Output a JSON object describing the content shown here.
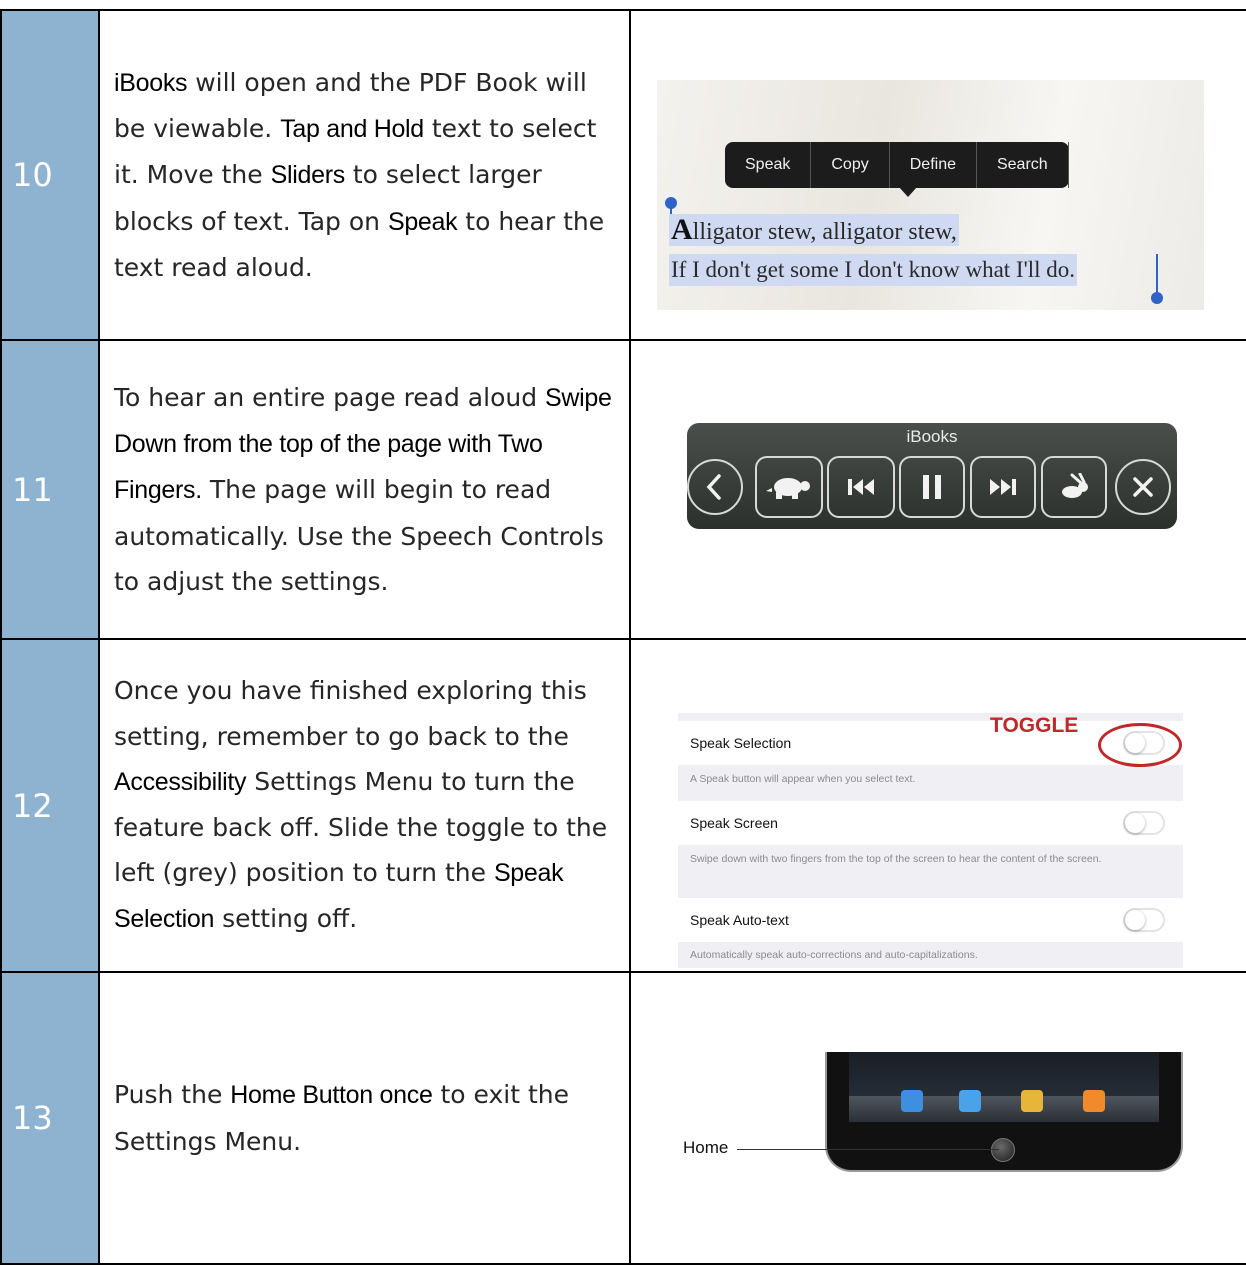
{
  "steps": [
    {
      "number": "10",
      "segments": [
        {
          "t": "iBooks",
          "k": true
        },
        {
          "t": " will open and the PDF Book will be viewable. ",
          "k": false
        },
        {
          "t": "Tap and Hold",
          "k": true
        },
        {
          "t": " text to select it. Move the ",
          "k": false
        },
        {
          "t": "Sliders",
          "k": true
        },
        {
          "t": " to select larger blocks of text. Tap on ",
          "k": false
        },
        {
          "t": "Speak",
          "k": true
        },
        {
          "t": " to hear the text read aloud.",
          "k": false
        }
      ]
    },
    {
      "number": "11",
      "segments": [
        {
          "t": "To hear an entire page read aloud ",
          "k": false
        },
        {
          "t": "Swipe Down from the top of the page with Two Fingers.",
          "k": true
        },
        {
          "t": " The page will begin to read automatically.  Use the Speech Controls to adjust the settings.",
          "k": false
        }
      ]
    },
    {
      "number": "12",
      "segments": [
        {
          "t": "Once you have finished exploring this setting, remember to go back to the ",
          "k": false
        },
        {
          "t": "Accessibility",
          "k": true
        },
        {
          "t": " Settings Menu to turn the feature back off. Slide the toggle to the left (grey) position to turn the ",
          "k": false
        },
        {
          "t": "Speak Selection",
          "k": true
        },
        {
          "t": " setting off.",
          "k": false
        }
      ]
    },
    {
      "number": "13",
      "segments": [
        {
          "t": "Push the ",
          "k": false
        },
        {
          "t": "Home Button once",
          "k": true
        },
        {
          "t": " to exit the Settings Menu.",
          "k": false
        }
      ]
    }
  ],
  "step10_image": {
    "menu": [
      "Speak",
      "Copy",
      "Define",
      "Search"
    ],
    "line1_cap": "A",
    "line1_rest": "lligator stew, alligator stew,",
    "line2": "If I don't get some I don't know what I'll do."
  },
  "step11_image": {
    "title": "iBooks",
    "icons": [
      "back-chevron-icon",
      "turtle-icon",
      "rewind-icon",
      "pause-icon",
      "fast-forward-icon",
      "rabbit-icon",
      "close-icon"
    ]
  },
  "step12_image": {
    "annotation": "TOGGLE",
    "rows": [
      {
        "label": "Speak Selection",
        "note": "A Speak button will appear when you select text."
      },
      {
        "label": "Speak Screen",
        "note": "Swipe down with two fingers from the top of the screen to hear the content of the screen."
      },
      {
        "label": "Speak Auto-text",
        "note": "Automatically speak auto-corrections and auto-capitalizations."
      }
    ]
  },
  "step13_image": {
    "home_label": "Home"
  },
  "colors": {
    "number_column": "#8db3d0",
    "toggle_annotation": "#c0282a",
    "selection_highlight": "#cfdaf2"
  }
}
